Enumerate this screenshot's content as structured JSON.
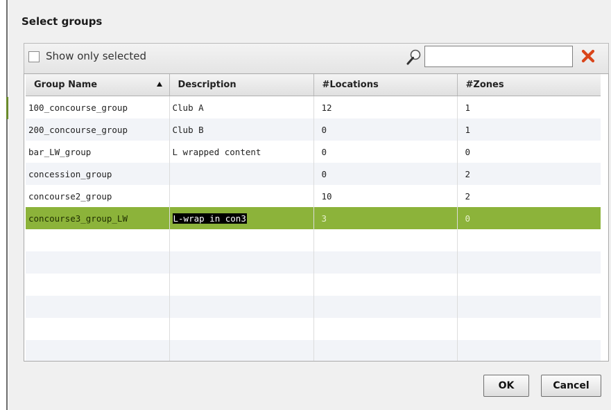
{
  "dialog": {
    "title": "Select groups",
    "toolbar": {
      "show_only_selected_label": "Show only selected",
      "show_only_selected_checked": false,
      "search_value": "",
      "search_placeholder": "",
      "search_icon": "magnifier-icon",
      "clear_icon": "red-x-icon"
    },
    "table": {
      "columns": [
        "Group Name",
        "Description",
        "#Locations",
        "#Zones"
      ],
      "sorted_column": "Group Name",
      "sort_direction": "ascending",
      "rows": [
        {
          "name": "100_concourse_group",
          "description": "Club A",
          "locations": "12",
          "zones": "1"
        },
        {
          "name": "200_concourse_group",
          "description": "Club B",
          "locations": "0",
          "zones": "1"
        },
        {
          "name": "bar_LW_group",
          "description": "L wrapped content",
          "locations": "0",
          "zones": "0"
        },
        {
          "name": "concession_group",
          "description": "",
          "locations": "0",
          "zones": "2"
        },
        {
          "name": "concourse2_group",
          "description": "",
          "locations": "10",
          "zones": "2"
        },
        {
          "name": "concourse3_group_LW",
          "description": "L-wrap in con3",
          "locations": "3",
          "zones": "0"
        }
      ],
      "selected_row": 5
    },
    "buttons": {
      "ok_label": "OK",
      "cancel_label": "Cancel"
    },
    "colors": {
      "selection": "#8cb33a",
      "alt_row": "#f2f4f8",
      "clear_icon": "#d9451a"
    }
  }
}
